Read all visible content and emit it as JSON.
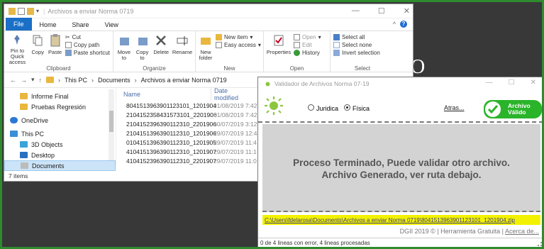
{
  "desktop": {
    "letter": "O"
  },
  "explorer": {
    "title": "Archivos a enviar Norma 0719",
    "tabs": [
      "File",
      "Home",
      "Share",
      "View"
    ],
    "ribbon": {
      "clipboard": {
        "pin": "Pin to Quick access",
        "copy": "Copy",
        "paste": "Paste",
        "cut": "Cut",
        "copy_path": "Copy path",
        "paste_shortcut": "Paste shortcut",
        "label": "Clipboard"
      },
      "organize": {
        "move": "Move to",
        "copy": "Copy to",
        "delete": "Delete",
        "rename": "Rename",
        "label": "Organize"
      },
      "new": {
        "new_folder": "New folder",
        "new_item": "New item",
        "easy_access": "Easy access",
        "label": "New"
      },
      "open": {
        "properties": "Properties",
        "open": "Open",
        "edit": "Edit",
        "history": "History",
        "label": "Open"
      },
      "select": {
        "select_all": "Select all",
        "select_none": "Select none",
        "invert": "Invert selection",
        "label": "Select"
      }
    },
    "address": {
      "crumbs": [
        "This PC",
        "Documents",
        "Archivos a enviar Norma 0719"
      ]
    },
    "nav": {
      "items": [
        {
          "label": "Informe Final",
          "type": "folder"
        },
        {
          "label": "Pruebas Regresión",
          "type": "folder"
        },
        {
          "label": "OneDrive",
          "type": "cloud"
        },
        {
          "label": "This PC",
          "type": "pc"
        },
        {
          "label": "3D Objects",
          "type": "obj"
        },
        {
          "label": "Desktop",
          "type": "desk"
        },
        {
          "label": "Documents",
          "type": "doc"
        }
      ]
    },
    "columns": {
      "name": "Name",
      "date": "Date modified"
    },
    "files": [
      {
        "name": "8041513963901123101_1201904",
        "date": "01/08/2019 7:42"
      },
      {
        "name": "2104152358431573101_2201906",
        "date": "01/08/2019 7:42"
      },
      {
        "name": "2104152396390112310_2201906",
        "date": "30/07/2019 3:12"
      },
      {
        "name": "2104151396390112310_1201906",
        "date": "29/07/2019 12:4"
      },
      {
        "name": "0104151396390112310_1201905",
        "date": "29/07/2019 11:4"
      },
      {
        "name": "4104151396390112310_1201907",
        "date": "29/07/2019 11:1"
      },
      {
        "name": "4104152396390112310_2201907",
        "date": "29/07/2019 11:0"
      }
    ],
    "status": "7 items"
  },
  "dialog": {
    "title": "Validador de Archivos Norma 07-19",
    "radio_juridica": "Juridica",
    "radio_fisica": "Física",
    "atras": "Atras...",
    "valid_line1": "Archivo",
    "valid_line2": "Válido",
    "message_line1": "Proceso Terminado, Puede validar otro archivo.",
    "message_line2": "Archivo Generado, ver ruta debajo.",
    "path": "C:\\Users\\fdelarosa\\Documents\\Archivos a enviar Norma 0719\\8041513963901123101_1201904.zip",
    "footer_text": "DGII 2019 © | Herramienta Gratuita |",
    "footer_link": "Acerca de...",
    "status": "0 de 4 lineas con error, 4 lineas procesadas"
  }
}
